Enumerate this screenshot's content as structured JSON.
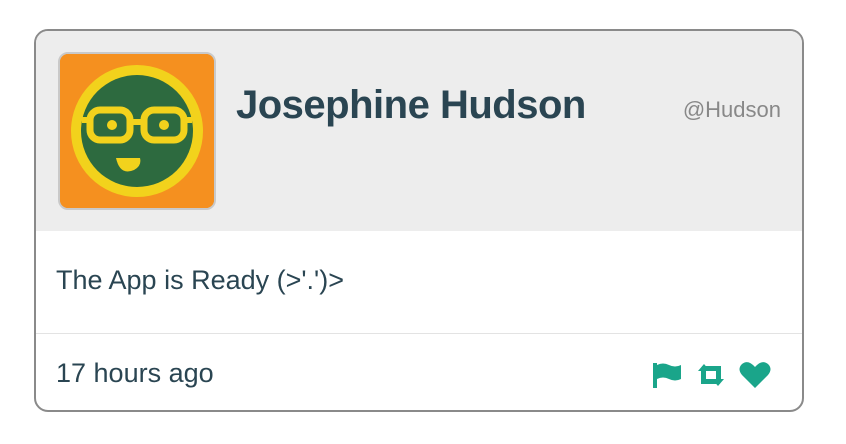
{
  "profile": {
    "name": "Josephine Hudson",
    "handle": "@Hudson",
    "avatar_icon": "nerd-face-avatar"
  },
  "message": {
    "text": "The App is Ready (>'.')>"
  },
  "footer": {
    "timestamp": "17 hours ago",
    "actions": [
      {
        "icon": "flag-icon",
        "label": "flag"
      },
      {
        "icon": "retweet-icon",
        "label": "retweet"
      },
      {
        "icon": "heart-icon",
        "label": "like"
      }
    ]
  },
  "colors": {
    "accent": "#1aa58a",
    "text": "#2a4552",
    "handle": "#888888",
    "header_bg": "#ededed",
    "avatar_bg": "#f5901f",
    "avatar_face": "#2d6a3f",
    "avatar_rim": "#f2d21c"
  }
}
